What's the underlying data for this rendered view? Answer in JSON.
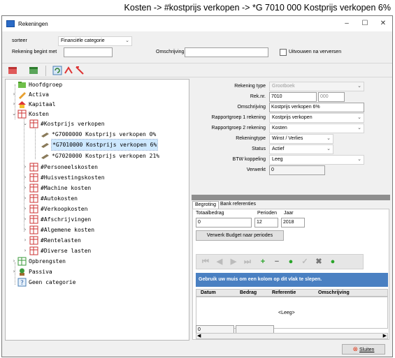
{
  "caption": "Kosten -> #kostprijs verkopen -> *G 7010 000 Kostprijs verkopen 6%",
  "window": {
    "title": "Rekeningen",
    "minimize": "–",
    "maximize": "☐",
    "close": "✕"
  },
  "filter": {
    "sorteer_label": "sorteer",
    "sorteer_value": "Financiële categorie",
    "begint_label": "Rekening begint met",
    "begint_value": "",
    "omschrijving_label": "Omschrijving",
    "omschrijving_value": "",
    "uitvouwen_label": "Uitvouwen na verversen"
  },
  "tree": {
    "items": [
      {
        "label": "Hoofdgroep"
      },
      {
        "label": "Activa"
      },
      {
        "label": "Kapitaal"
      },
      {
        "label": "Kosten"
      },
      {
        "label": "#Kostprijs verkopen"
      },
      {
        "label": "*G7000000 Kostprijs verkopen 0%"
      },
      {
        "label": "*G7010000 Kostprijs verkopen 6%"
      },
      {
        "label": "*G7020000 Kostprijs verkopen 21%"
      },
      {
        "label": "#Personeelskosten"
      },
      {
        "label": "#Huisvestingskosten"
      },
      {
        "label": "#Machine kosten"
      },
      {
        "label": "#Autokosten"
      },
      {
        "label": "#Verkoopkosten"
      },
      {
        "label": "#Afschrijvingen"
      },
      {
        "label": "#Algemene kosten"
      },
      {
        "label": "#Rentelasten"
      },
      {
        "label": "#Diverse lasten"
      },
      {
        "label": "Opbrengsten"
      },
      {
        "label": "Passiva"
      },
      {
        "label": "Geen categorie"
      }
    ]
  },
  "detail": {
    "rekeningtype_label": "Rekening type",
    "rekeningtype_value": "Grootboek",
    "reknr_label": "Rek.nr.",
    "reknr_value": "7010",
    "reknr_sub": "000",
    "omschrijving_label": "Omschrijving",
    "omschrijving_value": "Kostprijs verkopen 6%",
    "rg1_label": "Rapportgroep 1 rekening",
    "rg1_value": "Kostprijs verkopen",
    "rg2_label": "Rapportgroep 2 rekening",
    "rg2_value": "Kosten",
    "rekeningtype2_label": "Rekeningtype",
    "rekeningtype2_value": "Winst / Verlies",
    "status_label": "Status",
    "status_value": "Actief",
    "btw_label": "BTW koppeling",
    "btw_value": "Leeg",
    "verwerkt_label": "Verwerkt",
    "verwerkt_value": "0"
  },
  "tabs": {
    "begroting": "Begroting",
    "bank": "Bank referenties"
  },
  "begroting": {
    "totaal_label": "Totaalbedrag",
    "totaal_value": "0",
    "perioden_label": "Perioden",
    "perioden_value": "12",
    "jaar_label": "Jaar",
    "jaar_value": "2018",
    "verwerk_button": "Verwerk Budget naar periodes",
    "group_hint": "Gebruik uw muis om een kolom op dit vlak te slepen.",
    "columns": [
      "Datum",
      "Bedrag",
      "Referentie",
      "Omschrijving"
    ],
    "empty": "<Leeg>",
    "footer_value": "0"
  },
  "footer": {
    "sluiten": "Sluiten"
  }
}
